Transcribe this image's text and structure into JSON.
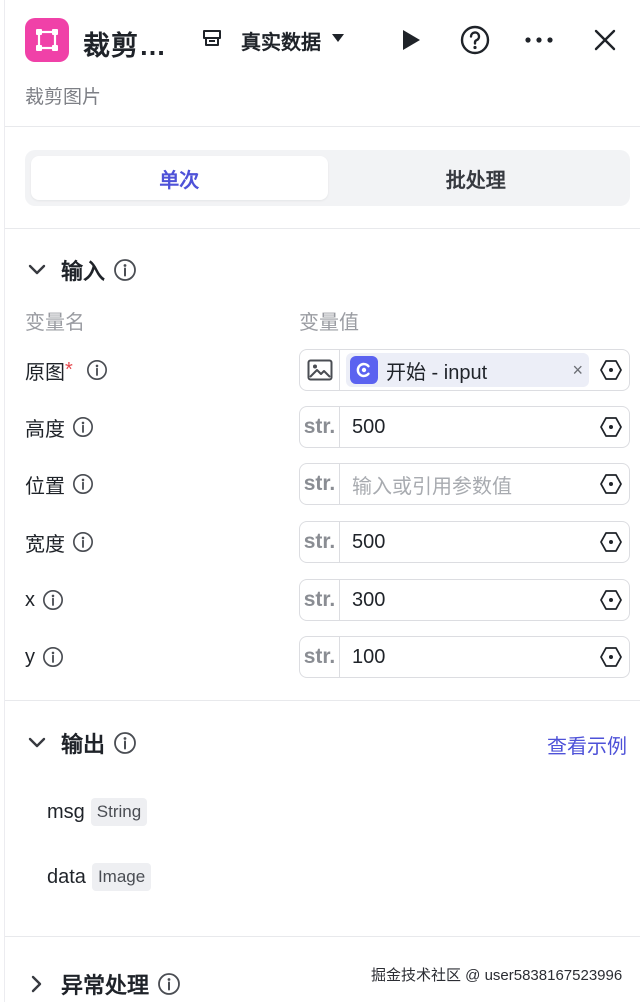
{
  "header": {
    "title": "裁剪…",
    "subtitle": "裁剪图片",
    "data_mode_label": "真实数据",
    "icons": [
      "crop-node-icon",
      "database-icon",
      "caret-down-icon",
      "play-icon",
      "help-icon",
      "more-icon",
      "close-icon"
    ]
  },
  "tabs": [
    {
      "label": "单次",
      "active": true
    },
    {
      "label": "批处理",
      "active": false
    }
  ],
  "input": {
    "title": "输入",
    "col_name": "变量名",
    "col_value": "变量值",
    "rows": [
      {
        "name": "原图",
        "required": true,
        "type": "image",
        "ref_label": "开始 - input"
      },
      {
        "name": "高度",
        "type": "str",
        "value": "500"
      },
      {
        "name": "位置",
        "type": "str",
        "value": "",
        "placeholder": "输入或引用参数值"
      },
      {
        "name": "宽度",
        "type": "str",
        "value": "500"
      },
      {
        "name": "x",
        "type": "str",
        "value": "300"
      },
      {
        "name": "y",
        "type": "str",
        "value": "100"
      }
    ],
    "type_label": "str.",
    "required_mark": "*",
    "chip_close": "×"
  },
  "output": {
    "title": "输出",
    "example_link": "查看示例",
    "rows": [
      {
        "name": "msg",
        "type": "String"
      },
      {
        "name": "data",
        "type": "Image"
      }
    ]
  },
  "exception": {
    "title": "异常处理"
  },
  "watermark": "掘金技术社区 @ user5838167523996",
  "colors": {
    "accent": "#4e52d8",
    "node_icon_bg": "#f041a8",
    "chip_icon_bg": "#5b62f0",
    "required": "#e5484d"
  }
}
